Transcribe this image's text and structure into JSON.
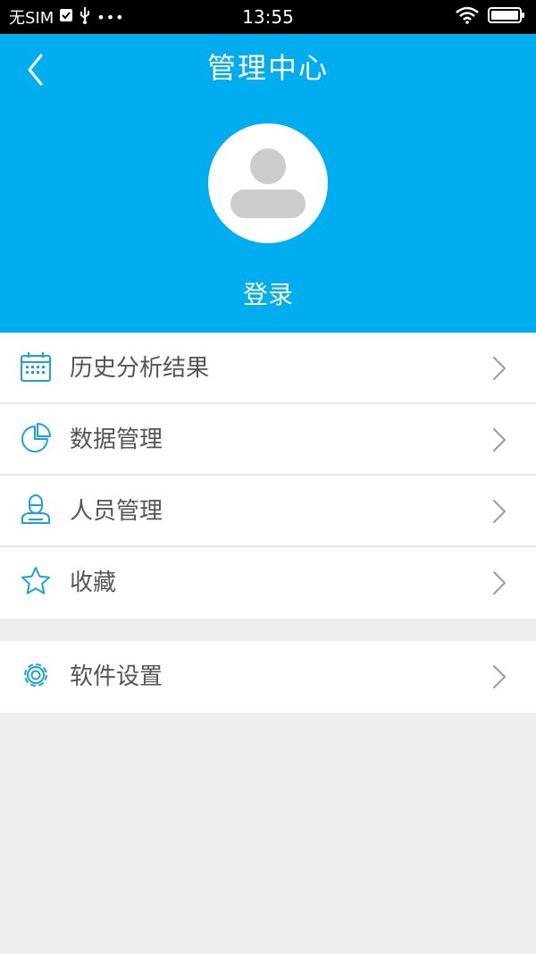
{
  "status_bar": {
    "carrier": "无SIM",
    "time": "13:55",
    "icons": [
      "check-icon",
      "usb-icon",
      "more-dots-icon",
      "wifi-icon",
      "battery-icon"
    ]
  },
  "header": {
    "title": "管理中心",
    "login_label": "登录",
    "bg_color": "#00aeef"
  },
  "menu": {
    "group1": [
      {
        "label": "历史分析结果",
        "icon": "calendar-icon"
      },
      {
        "label": "数据管理",
        "icon": "pie-chart-icon"
      },
      {
        "label": "人员管理",
        "icon": "user-icon"
      },
      {
        "label": "收藏",
        "icon": "star-icon"
      }
    ],
    "group2": [
      {
        "label": "软件设置",
        "icon": "gear-icon"
      }
    ]
  },
  "colors": {
    "accent": "#00aeef",
    "icon": "#1aa2dc",
    "text": "#555555",
    "chevron": "#9b9b9b",
    "page_bg": "#efefef"
  }
}
